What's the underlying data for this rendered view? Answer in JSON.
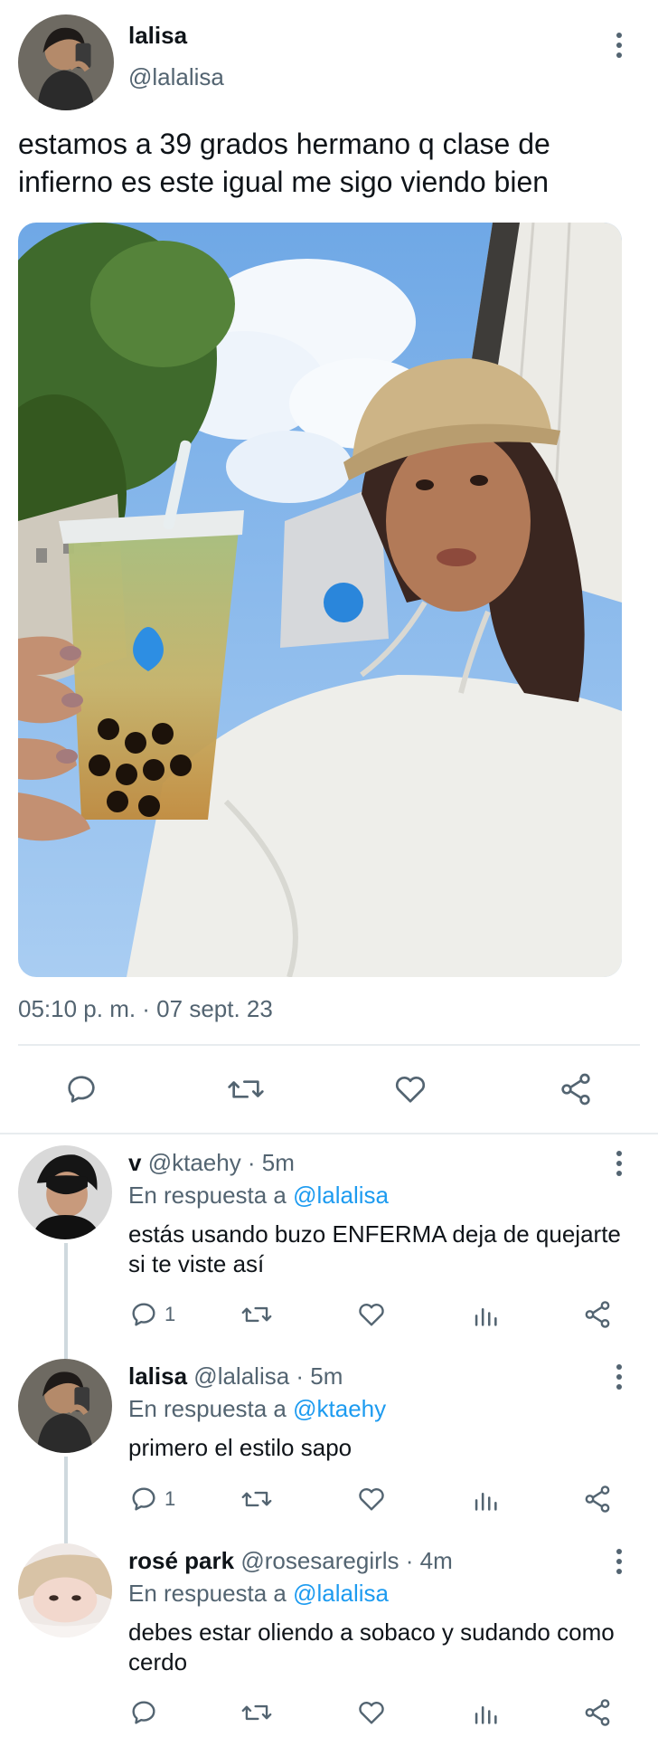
{
  "tweet": {
    "author_name": "lalisa",
    "author_handle": "@lalalisa",
    "text": "estamos a 39 grados hermano q clase de infierno es este igual me sigo viendo bien",
    "timestamp": "05:10 p. m. · 07 sept. 23"
  },
  "replies": [
    {
      "name": "v",
      "handle_time": "@ktaehy · 5m",
      "replying_prefix": "En respuesta a",
      "replying_to": "@lalalisa",
      "text": "estás usando buzo ENFERMA deja de quejarte si te viste así",
      "reply_count": "1"
    },
    {
      "name": "lalisa",
      "handle_time": "@lalalisa · 5m",
      "replying_prefix": "En respuesta a",
      "replying_to": "@ktaehy",
      "text": "primero el estilo sapo",
      "reply_count": "1"
    },
    {
      "name": "rosé park",
      "handle_time": "@rosesaregirls · 4m",
      "replying_prefix": "En respuesta a",
      "replying_to": "@lalalisa",
      "text": "debes estar oliendo a sobaco y sudando como cerdo",
      "reply_count": ""
    }
  ],
  "colors": {
    "text_primary": "#0f1419",
    "text_secondary": "#536471",
    "link": "#1d9bf0",
    "icon": "#536471"
  },
  "icons": [
    "more-vertical-icon",
    "reply-icon",
    "retweet-icon",
    "like-icon",
    "share-icon",
    "analytics-icon"
  ]
}
